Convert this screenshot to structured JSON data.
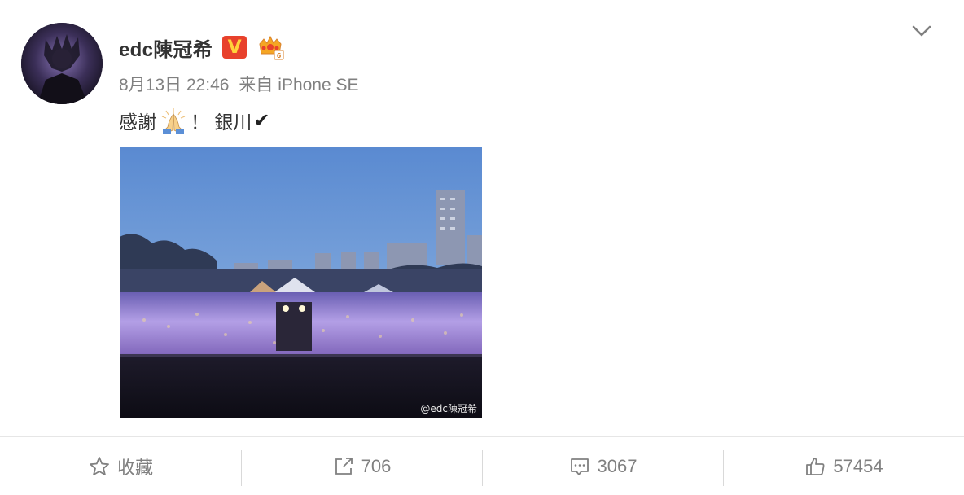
{
  "post": {
    "username": "edc陳冠希",
    "verified_badge": "V",
    "crown_badge_icon": "crown-icon",
    "date": "8月13日 22:46",
    "source_prefix": "来自",
    "source_device": "iPhone SE",
    "text_before_emoji": "感謝",
    "emoji_icon": "praying-hands-icon",
    "text_after_emoji": "！ 銀川",
    "check_mark": "✔",
    "image_watermark": "@edc陳冠希"
  },
  "actions": {
    "favorite_label": "收藏",
    "repost_count": "706",
    "comment_count": "3067",
    "like_count": "57454"
  },
  "colors": {
    "verified_badge_bg": "#e8412c",
    "verified_badge_fg": "#ffd33a",
    "text_primary": "#333333",
    "text_meta": "#808080"
  }
}
